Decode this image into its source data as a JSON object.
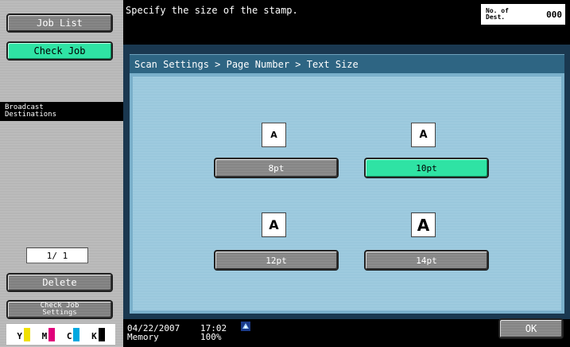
{
  "sidebar": {
    "job_list_label": "Job List",
    "check_job_label": "Check Job",
    "broadcast_line1": "Broadcast",
    "broadcast_line2": "Destinations",
    "page_count": "1/  1",
    "delete_label": "Delete",
    "check_job_settings_line1": "Check Job",
    "check_job_settings_line2": "Settings",
    "toner": [
      {
        "letter": "Y",
        "color": "#f0e000"
      },
      {
        "letter": "M",
        "color": "#e0007a"
      },
      {
        "letter": "C",
        "color": "#00a8e0"
      },
      {
        "letter": "K",
        "color": "#000000"
      }
    ]
  },
  "header": {
    "message": "Specify the size of the stamp.",
    "dest_label_line1": "No. of",
    "dest_label_line2": "Dest.",
    "dest_count": "000"
  },
  "panel": {
    "breadcrumb": "Scan Settings > Page Number > Text Size",
    "sample_letter": "A",
    "options": [
      {
        "label": "8pt",
        "selected": false
      },
      {
        "label": "10pt",
        "selected": true
      },
      {
        "label": "12pt",
        "selected": false
      },
      {
        "label": "14pt",
        "selected": false
      }
    ]
  },
  "status": {
    "date": "04/22/2007",
    "time": "17:02",
    "memory_label": "Memory",
    "memory_value": "100%",
    "ok_label": "OK",
    "network_icon": "network-icon"
  },
  "colors": {
    "selected": "#2fe3a4",
    "panel_bg": "#8fbfd6",
    "breadcrumb_bg": "#2e6583"
  }
}
